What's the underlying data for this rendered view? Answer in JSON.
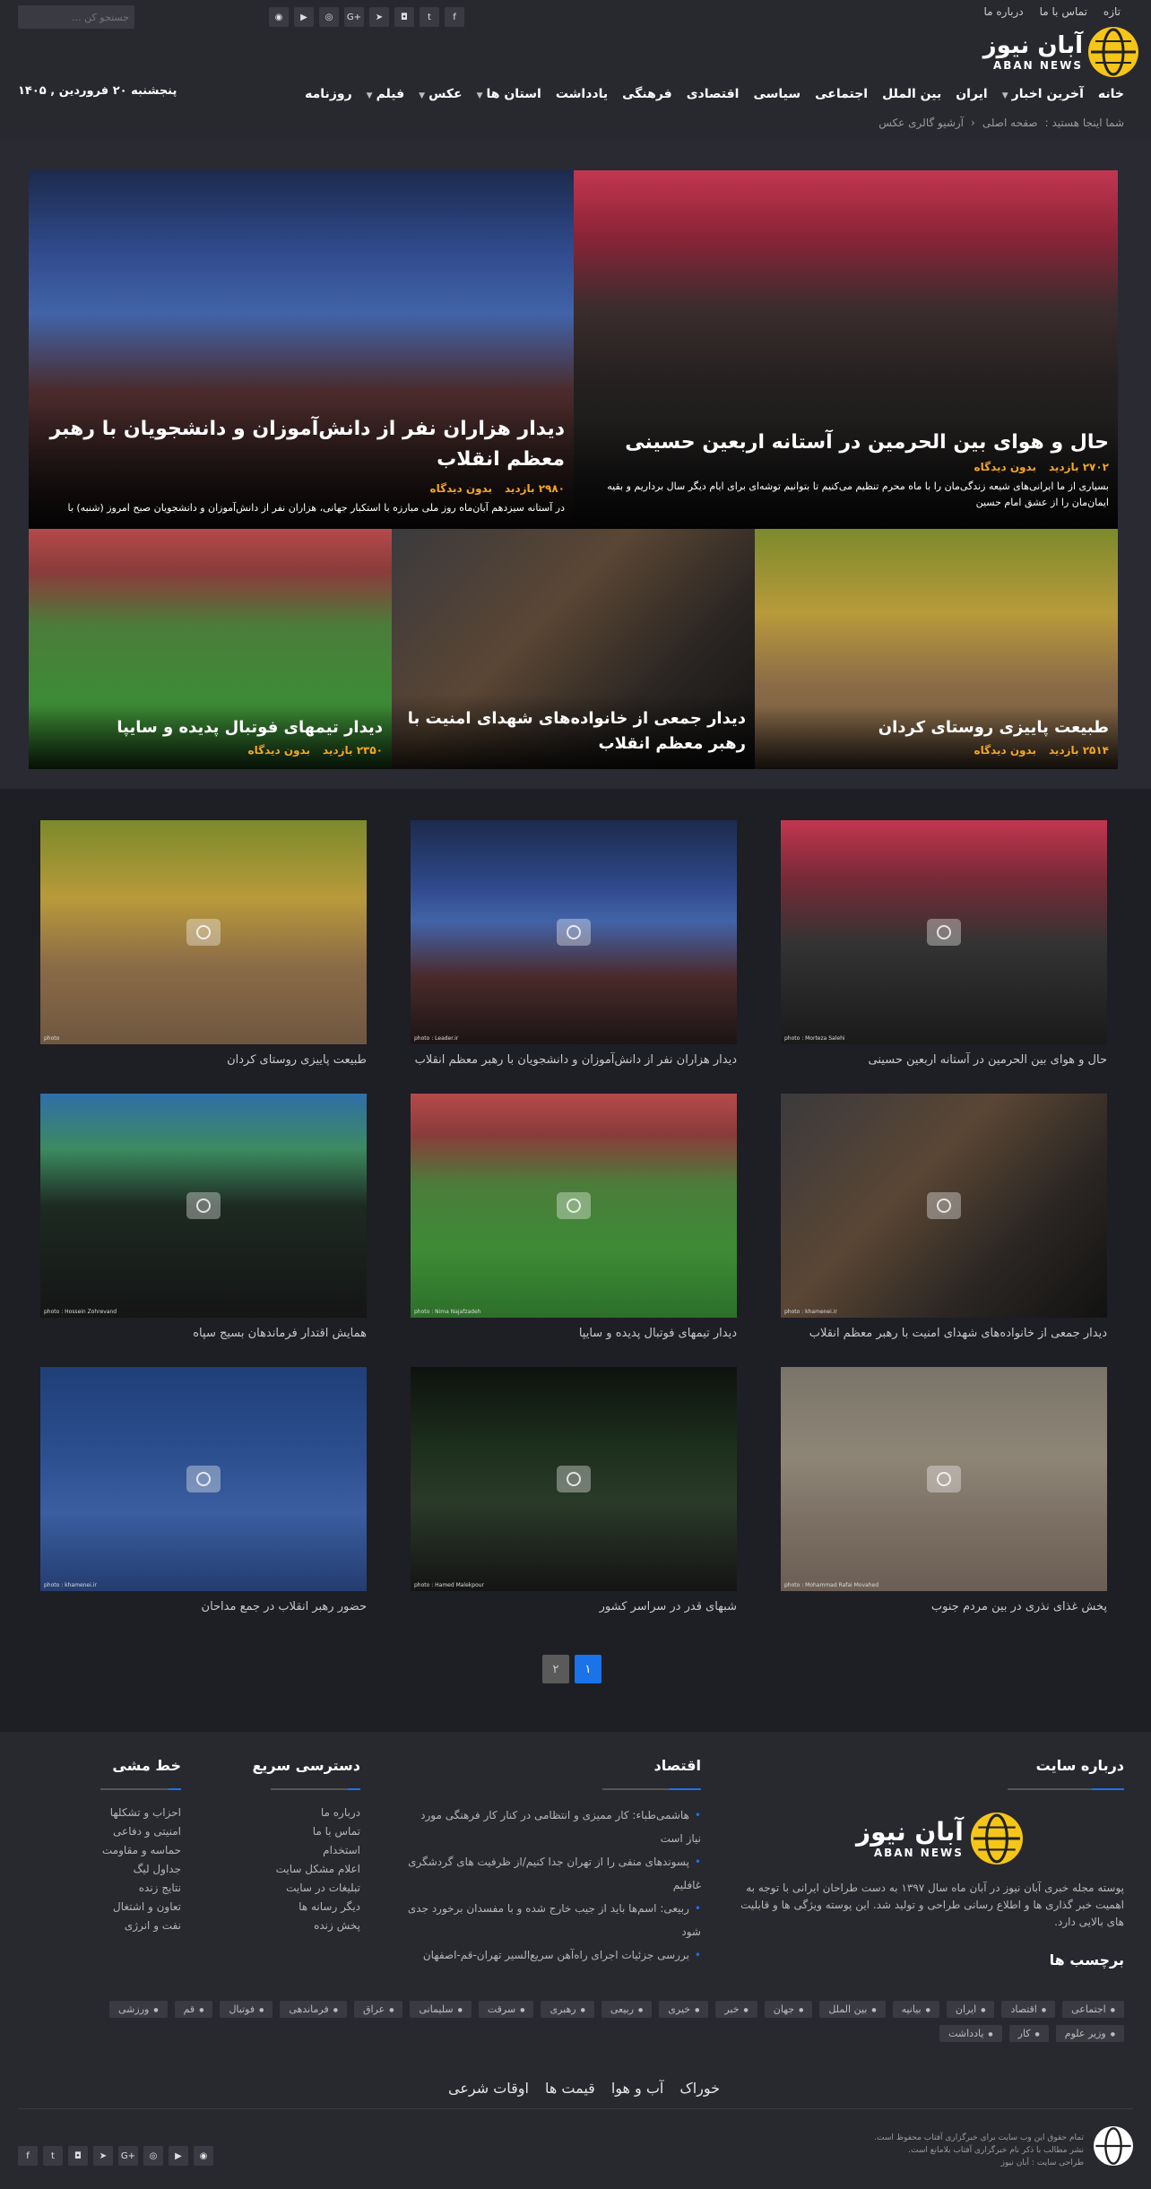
{
  "header": {
    "top_links": [
      "تازه",
      "تماس با ما",
      "درباره ما"
    ],
    "search_placeholder": "جستجو کن ...",
    "socials": [
      "facebook",
      "twitter",
      "instagram",
      "telegram",
      "google-plus",
      "dribbble",
      "youtube",
      "rss"
    ],
    "logo_fa": "آبان نیوز",
    "logo_en": "ABAN NEWS",
    "date": "پنجشنبه ۲۰ فروردین , ۱۴۰۵",
    "nav": [
      "خانه",
      "آخرین اخبار",
      "ایران",
      "بین الملل",
      "اجتماعی",
      "سیاسی",
      "اقتصادی",
      "فرهنگی",
      "یادداشت",
      "استان ها",
      "عکس",
      "فیلم",
      "روزنامه"
    ],
    "breadcrumb": [
      "شما اینجا هستید :",
      "صفحه اصلی",
      "آرشیو گالری عکس"
    ]
  },
  "slider": {
    "main1": {
      "title": "حال و هوای بین الحرمین در آستانه اربعین حسینی",
      "views": "۲۷۰۲ بازدید",
      "comments": "بدون دیدگاه",
      "summary": "بسیاری از ما ایرانی‌های شیعه زندگی‌مان را با ماه محرم تنظیم می‌کنیم تا بتوانیم توشه‌ای برای ایام دیگر سال برداریم و بقیه ایمان‌مان را از عشق امام حسین"
    },
    "main2": {
      "title": "دیدار هزاران نفر از دانش‌آموزان و دانشجویان با رهبر معظم انقلاب",
      "views": "۲۹۸۰ بازدید",
      "comments": "بدون دیدگاه",
      "summary": "در آستانه سیزدهم آبان‌ماه روز ملی مبارزه با استکبار جهانی، هزاران نفر از دانش‌آموزان و دانشجویان صبح امروز (شنبه) با"
    },
    "small1": {
      "title": "طبیعت پاییزی روستای کردان",
      "views": "۲۵۱۴ بازدید",
      "comments": "بدون دیدگاه"
    },
    "small2": {
      "title": "دیدار جمعی از خانواده‌های شهدای امنیت با رهبر معظم انقلاب",
      "views": "",
      "comments": ""
    },
    "small3": {
      "title": "دیدار تیمهای فوتبال پدیده و سایپا",
      "views": "۲۳۵۰ بازدید",
      "comments": "بدون دیدگاه"
    }
  },
  "gallery": [
    {
      "caption": "حال و هوای بین الحرمین در آستانه اربعین حسینی",
      "credit": "photo : Morteza Salehi"
    },
    {
      "caption": "دیدار هزاران نفر از دانش‌آموزان و دانشجویان با رهبر معظم انقلاب",
      "credit": "photo : Leader.ir"
    },
    {
      "caption": "طبیعت پاییزی روستای کردان",
      "credit": "photo"
    },
    {
      "caption": "دیدار جمعی از خانواده‌های شهدای امنیت با رهبر معظم انقلاب",
      "credit": "photo : khamenei.ir"
    },
    {
      "caption": "دیدار تیمهای فوتبال پدیده و سایپا",
      "credit": "photo : Nima Najafzadeh"
    },
    {
      "caption": "همایش اقتدار فرماندهان بسیج سپاه",
      "credit": "photo : Hossein Zohrevand"
    },
    {
      "caption": "پخش غذای نذری در بین مردم جنوب",
      "credit": "photo : Mohammad Rafai Movahed"
    },
    {
      "caption": "شبهای قدر در سراسر کشور",
      "credit": "photo : Hamed Malekpour"
    },
    {
      "caption": "حضور رهبر انقلاب در جمع مداحان",
      "credit": "photo : khamenei.ir"
    }
  ],
  "pagination": {
    "pages": [
      "۱",
      "۲"
    ],
    "active": "۱"
  },
  "footer": {
    "about_title": "درباره سایت",
    "about_text": "پوسته مجله خبری آبان نیوز در آبان ماه سال ۱۳۹۷ به دست طراحان ایرانی با توجه به اهمیت خبر گذاری ها و اطلاع رسانی طراحی و تولید شد. این پوسته ویژگی ها و قابلیت های بالایی دارد.",
    "economy_title": "اقتصاد",
    "economy_items": [
      "هاشمی‌طباء: کار ممیزی و انتظامی در کنار کار فرهنگی مورد نیاز است",
      "پسوندهای منفی را از تهران جدا کنیم/از ظرفیت های گردشگری غافلیم",
      "ربیعی: اسم‌ها باید از جیب خارج شده و با مفسدان برخورد جدی شود",
      "بررسی جزئیات اجرای راه‌آهن سریع‌السیر تهران-قم-اصفهان"
    ],
    "quick_title": "دسترسی سریع",
    "quick_items": [
      "درباره ما",
      "تماس با ما",
      "استخدام",
      "اعلام مشکل سایت",
      "تبلیغات در سایت",
      "دیگر رسانه ها",
      "پخش زنده"
    ],
    "line_title": "خط مشی",
    "line_items": [
      "احزاب و تشکلها",
      "امنیتی و دفاعی",
      "حماسه و مقاومت",
      "جداول لیگ",
      "نتایج زنده",
      "تعاون و اشتغال",
      "نفت و انرژی"
    ],
    "tags_title": "برچسب ها",
    "tags": [
      "اجتماعی",
      "اقتصاد",
      "ایران",
      "بیانیه",
      "بین الملل",
      "جهان",
      "خبر",
      "خیری",
      "ربیعی",
      "رهبری",
      "سرقت",
      "سلیمانی",
      "عراق",
      "فرماندهی",
      "فوتبال",
      "قم",
      "ورزشی",
      "وزیر علوم",
      "کار",
      "یادداشت"
    ],
    "links": [
      "خوراک",
      "آب و هوا",
      "قیمت ها",
      "اوقات شرعی"
    ],
    "copyright": [
      "تمام حقوق این وب سایت برای خبرگزاری آفتاب محفوظ است.",
      "نشر مطالب با ذکر نام خبرگزاری آفتاب بلامانع است.",
      "طراحی سایت : آبان نیوز"
    ]
  },
  "colors": {
    "accent": "#1a73e8",
    "highlight": "#f5a623",
    "header_bg": "#28282f",
    "body_bg": "#1e1e25"
  }
}
